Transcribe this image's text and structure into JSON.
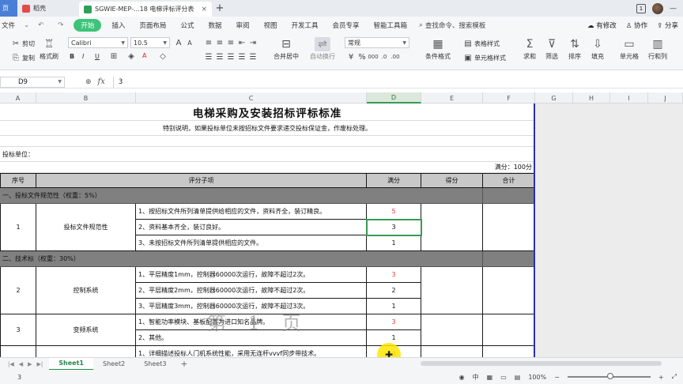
{
  "titlebar": {
    "tabs": [
      {
        "label": "页",
        "kind": "home"
      },
      {
        "label": "稻壳",
        "kind": "draft",
        "icon_color": "#e24b4b"
      },
      {
        "label": "SGWIE-MEP-...18 电梯评标评分表",
        "kind": "doc",
        "icon_color": "#2fa05a"
      }
    ],
    "new_tab": "+",
    "badge": "1"
  },
  "menu": {
    "items": [
      "文件",
      "开始",
      "插入",
      "页面布局",
      "公式",
      "数据",
      "审阅",
      "视图",
      "开发工具",
      "会员专享",
      "智能工具箱"
    ],
    "active": "开始",
    "search": "查找命令、搜索模板",
    "right": [
      "有修改",
      "协作",
      "分享"
    ]
  },
  "ribbon": {
    "cut": "剪切",
    "copy": "复制",
    "format_painter": "格式刷",
    "font_name": "Calibri",
    "font_size": "10.5",
    "merge": "合并居中",
    "wrap": "自动换行",
    "number_format": "常规",
    "table_style": "表格样式",
    "cond_format": "条件格式",
    "cell_style": "单元格样式",
    "sum": "求和",
    "filter": "筛选",
    "sort": "排序",
    "fill": "填充",
    "cell": "单元格",
    "row_col": "行和列",
    "b": "B",
    "i": "I",
    "u": "U",
    "a": "A"
  },
  "formula": {
    "name_box": "D9",
    "value": "3"
  },
  "columns": [
    "A",
    "B",
    "C",
    "D",
    "E",
    "F",
    "G",
    "H",
    "I",
    "J"
  ],
  "sheet": {
    "title": "电梯采购及安装招标评标标准",
    "note": "特别说明，如果投标单位未按招标文件要求递交投标保证金，作废标处理。",
    "bidder_label": "投标单位：",
    "full_score_note": "满分：100分",
    "headers": [
      "序号",
      "评分子项",
      "满分",
      "得分",
      "合计"
    ],
    "sections": [
      {
        "label": "一、投标文件规范性（权重：5%）"
      },
      {
        "label": "二、技术标（权重：30%）"
      }
    ],
    "groups": [
      {
        "no": "1",
        "name": "投标文件规范性",
        "rows": [
          {
            "text": "1、按招标文件所列清单提供给相应的文件，资料齐全，装订精良。",
            "score": "5",
            "red": true
          },
          {
            "text": "2、资料基本齐全，装订良好。",
            "score": "3",
            "red": false
          },
          {
            "text": "3、未按招标文件所列清单提供相应的文件。",
            "score": "1",
            "red": false
          }
        ]
      },
      {
        "no": "2",
        "name": "控制系统",
        "rows": [
          {
            "text": "1、平层精度1mm，控制器60000次运行，故障不超过2次。",
            "score": "3",
            "red": true
          },
          {
            "text": "2、平层精度2mm，控制器60000次运行，故障不超过2次。",
            "score": "2",
            "red": false
          },
          {
            "text": "3、平层精度3mm，控制器60000次运行，故障不超过3次。",
            "score": "1",
            "red": false
          }
        ]
      },
      {
        "no": "3",
        "name": "变频系统",
        "rows": [
          {
            "text": "1、智能功率模块、基板配置为进口知名品牌。",
            "score": "3",
            "red": true
          },
          {
            "text": "2、其他。",
            "score": "1",
            "red": false
          }
        ]
      },
      {
        "no": "",
        "name": "",
        "rows": [
          {
            "text": "1、详细描述投标人门机系统性能，采用无连杆vvvf同步带技术。",
            "score": "3",
            "red": true
          }
        ]
      }
    ],
    "watermark": "第 1 页"
  },
  "sheet_tabs": [
    "Sheet1",
    "Sheet2",
    "Sheet3"
  ],
  "add_sheet": "+",
  "status": {
    "left": "3",
    "input_mode": "中",
    "zoom": "100%"
  }
}
